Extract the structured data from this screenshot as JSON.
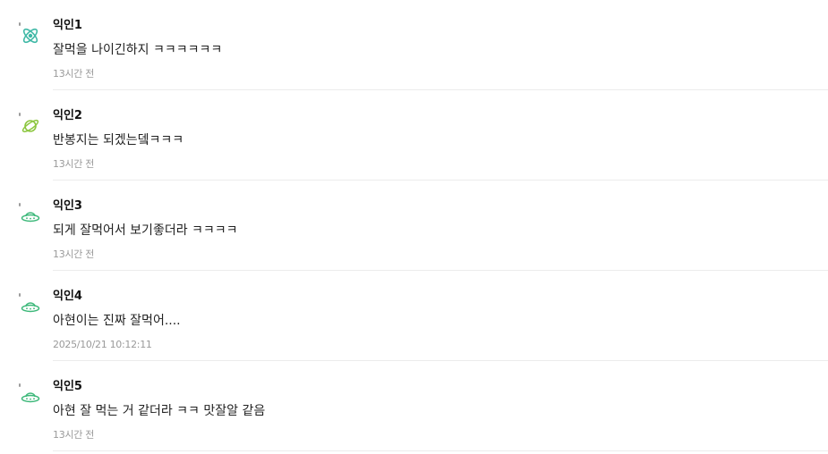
{
  "comments": [
    {
      "author": "익인1",
      "text": "잘먹을 나이긴하지 ㅋㅋㅋㅋㅋㅋ",
      "time": "13시간 전",
      "avatar_icon": "atom-icon",
      "avatar_color": "#3fb8a6"
    },
    {
      "author": "익인2",
      "text": "반봉지는 되겠는뎈ㅋㅋㅋ",
      "time": "13시간 전",
      "avatar_icon": "planet-icon",
      "avatar_color": "#8cc63f"
    },
    {
      "author": "익인3",
      "text": "되게 잘먹어서 보기좋더라 ㅋㅋㅋㅋ",
      "time": "13시간 전",
      "avatar_icon": "ufo-icon",
      "avatar_color": "#3db87a"
    },
    {
      "author": "익인4",
      "text": "아현이는 진짜 잘먹어....",
      "time": "2025/10/21 10:12:11",
      "avatar_icon": "ufo-icon",
      "avatar_color": "#3db87a"
    },
    {
      "author": "익인5",
      "text": "아현 잘 먹는 거 같더라 ㅋㅋ 맛잘알 같음",
      "time": "13시간 전",
      "avatar_icon": "ufo-icon",
      "avatar_color": "#3db87a"
    }
  ]
}
